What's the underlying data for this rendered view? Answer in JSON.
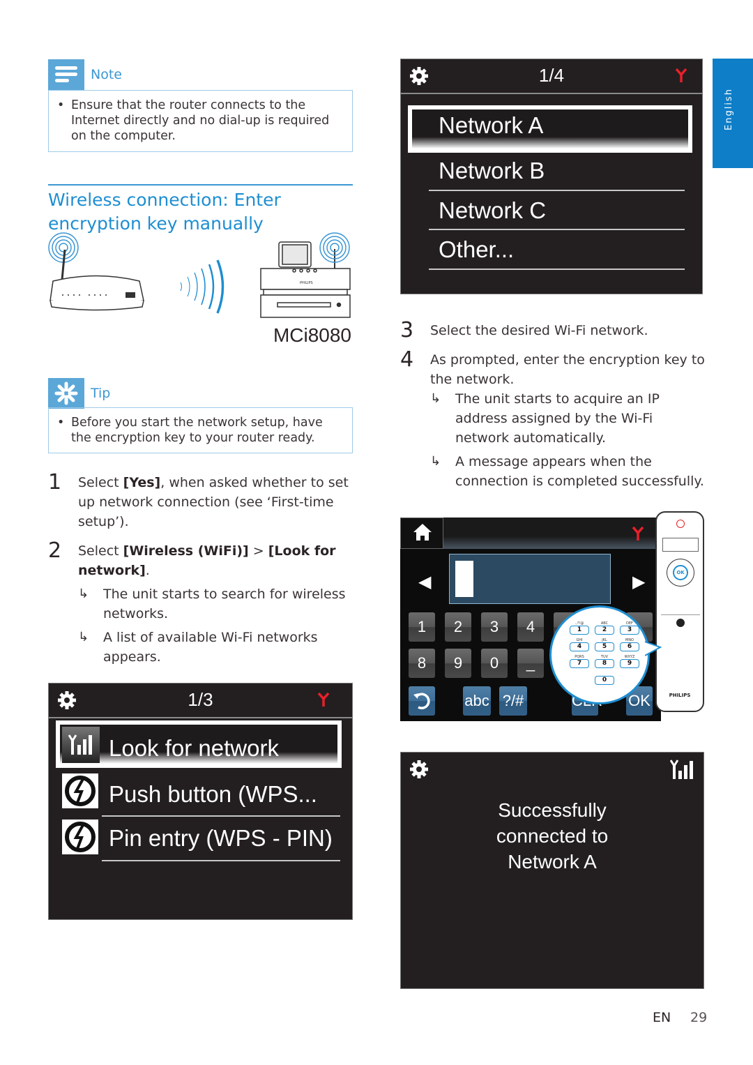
{
  "note": {
    "title": "Note",
    "icon": "note-icon",
    "bullets": [
      "Ensure that the router connects to the Internet directly and no dial-up is required on the computer."
    ]
  },
  "section": {
    "title_line1": "Wireless connection: Enter",
    "title_line2": "encryption key manually"
  },
  "illustration": {
    "device_model": "MCi8080",
    "brand": "PHILIPS"
  },
  "tip": {
    "title": "Tip",
    "icon": "tip-icon",
    "bullets": [
      "Before you start the network setup, have the encryption key to your router ready."
    ]
  },
  "steps": [
    {
      "num": "1",
      "pre": "Select ",
      "bold": "[Yes]",
      "post": ", when asked whether to set up network connection (see ‘First-time setup’).",
      "results": []
    },
    {
      "num": "2",
      "pre": "Select ",
      "bold": "[Wireless (WiFi)]",
      "mid": " > ",
      "bold2": "[Look for network]",
      "post": ".",
      "results": [
        "The unit starts to search for wireless networks.",
        "A list of available Wi-Fi networks appears."
      ]
    },
    {
      "num": "3",
      "text": "Select the desired Wi-Fi network.",
      "results": []
    },
    {
      "num": "4",
      "text": "As prompted, enter the encryption key to the network.",
      "results": [
        "The unit starts to acquire an IP address assigned by the Wi-Fi network automatically.",
        "A message appears when the connection is completed successfully."
      ]
    }
  ],
  "screen_wireless_menu": {
    "page": "1/3",
    "items": [
      {
        "label": "Look for network",
        "icon": "signal-icon",
        "selected": true
      },
      {
        "label": "Push button (WPS...",
        "icon": "wps-icon",
        "selected": false
      },
      {
        "label": "Pin entry (WPS - PIN)",
        "icon": "wps-icon",
        "selected": false
      }
    ]
  },
  "screen_network_list": {
    "page": "1/4",
    "items": [
      {
        "label": "Network A",
        "selected": true
      },
      {
        "label": "Network B",
        "selected": false
      },
      {
        "label": "Network C",
        "selected": false
      },
      {
        "label": "Other...",
        "selected": false
      }
    ]
  },
  "screen_keyboard": {
    "input_value": "",
    "row1": [
      "1",
      "2",
      "3",
      "4"
    ],
    "row2": [
      "8",
      "9",
      "0",
      "_"
    ],
    "bottom": {
      "back": "back-icon",
      "abc": "abc",
      "symbols": "?/#",
      "clear": "CLR",
      "ok": "OK"
    },
    "keypad_zoom": [
      {
        "key": "1",
        "letters": ".,?!@"
      },
      {
        "key": "2",
        "letters": "ABC"
      },
      {
        "key": "3",
        "letters": "DEF"
      },
      {
        "key": "4",
        "letters": "GHI"
      },
      {
        "key": "5",
        "letters": "JKL"
      },
      {
        "key": "6",
        "letters": "MNO"
      },
      {
        "key": "7",
        "letters": "PQRS"
      },
      {
        "key": "8",
        "letters": "TUV"
      },
      {
        "key": "9",
        "letters": "WXYZ"
      },
      {
        "key": "0",
        "letters": ""
      }
    ],
    "remote_brand": "PHILIPS",
    "remote_ok": "OK"
  },
  "screen_success": {
    "line1": "Successfully",
    "line2": "connected to",
    "line3": "Network A"
  },
  "side_tab": "English",
  "footer": {
    "lang": "EN",
    "page": "29"
  },
  "colors": {
    "accent": "#1e8ed1",
    "screen_bg": "#231f20",
    "antenna_red": "#e8202a",
    "tab_blue": "#0e7ec8"
  }
}
